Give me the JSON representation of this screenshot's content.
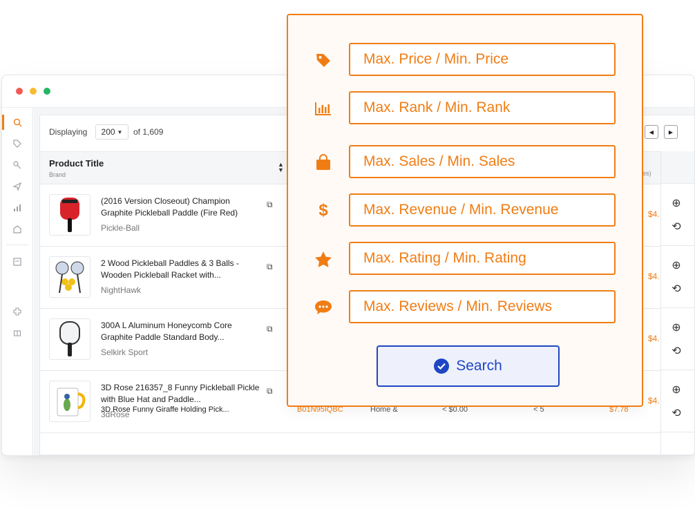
{
  "table": {
    "displaying_label": "Displaying",
    "page_size": "200",
    "of_total": "of 1,609",
    "col_title": "Product Title",
    "col_brand": "Brand",
    "col_fragment": "es)",
    "rows": [
      {
        "title": "(2016 Version Closeout) Champion Graphite Pickleball Paddle (Fire Red)",
        "brand": "Pickle-Ball",
        "price": "$4."
      },
      {
        "title": "2 Wood Pickleball Paddles & 3 Balls - Wooden Pickleball Racket with...",
        "brand": "NightHawk",
        "price": "$4."
      },
      {
        "title": "300A L Aluminum Honeycomb Core Graphite Paddle Standard Body...",
        "brand": "Selkirk Sport",
        "price": "$4."
      },
      {
        "title": "3D Rose 216357_8 Funny Pickleball Pickle with Blue Hat and Paddle...",
        "brand": "3dRose",
        "price": "$4."
      }
    ],
    "partial_row": {
      "title": "3D Rose Funny Giraffe Holding Pick...",
      "asin": "B01N95IQBC",
      "category": "Home &",
      "price": "< $0.00",
      "rank": "< 5",
      "revenue": "$7.78"
    }
  },
  "filters": [
    {
      "icon": "tag-icon",
      "label": "Max. Price / Min. Price"
    },
    {
      "icon": "bar-chart-icon",
      "label": "Max. Rank / Min. Rank"
    },
    {
      "icon": "shopping-bag-icon",
      "label": "Max. Sales / Min. Sales"
    },
    {
      "icon": "dollar-icon",
      "label": "Max. Revenue / Min. Revenue"
    },
    {
      "icon": "star-icon",
      "label": "Max. Rating / Min. Rating"
    },
    {
      "icon": "chat-icon",
      "label": "Max. Reviews / Min. Reviews"
    }
  ],
  "search_button": {
    "label": "Search"
  },
  "colors": {
    "accent": "#f07d14",
    "primary": "#1e46c4"
  }
}
